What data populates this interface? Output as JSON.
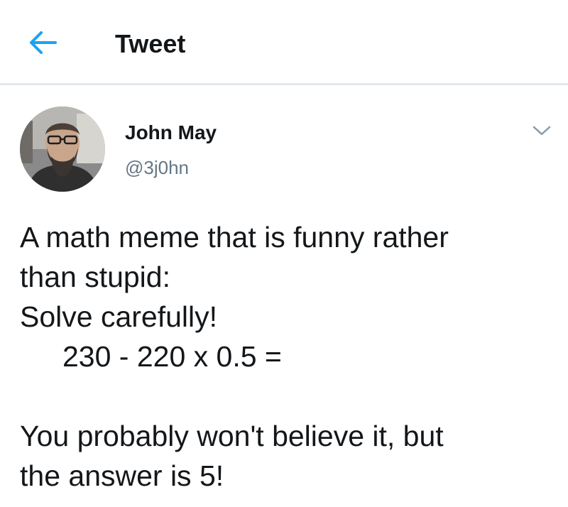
{
  "header": {
    "title": "Tweet",
    "back_icon": "arrow-left-icon",
    "accent_color": "#1da1f2"
  },
  "author": {
    "name": "John May",
    "handle": "@3j0hn",
    "avatar_icon": "user-avatar-photo",
    "menu_icon": "chevron-down-icon"
  },
  "tweet": {
    "lines": [
      "A math meme that is funny rather",
      "than stupid:",
      "Solve carefully!",
      "230 - 220 x 0.5 =",
      "",
      "You probably won't believe it, but",
      "the answer is 5!"
    ]
  },
  "colors": {
    "text_primary": "#14171a",
    "text_secondary": "#657786",
    "divider": "#e1e8ed"
  }
}
